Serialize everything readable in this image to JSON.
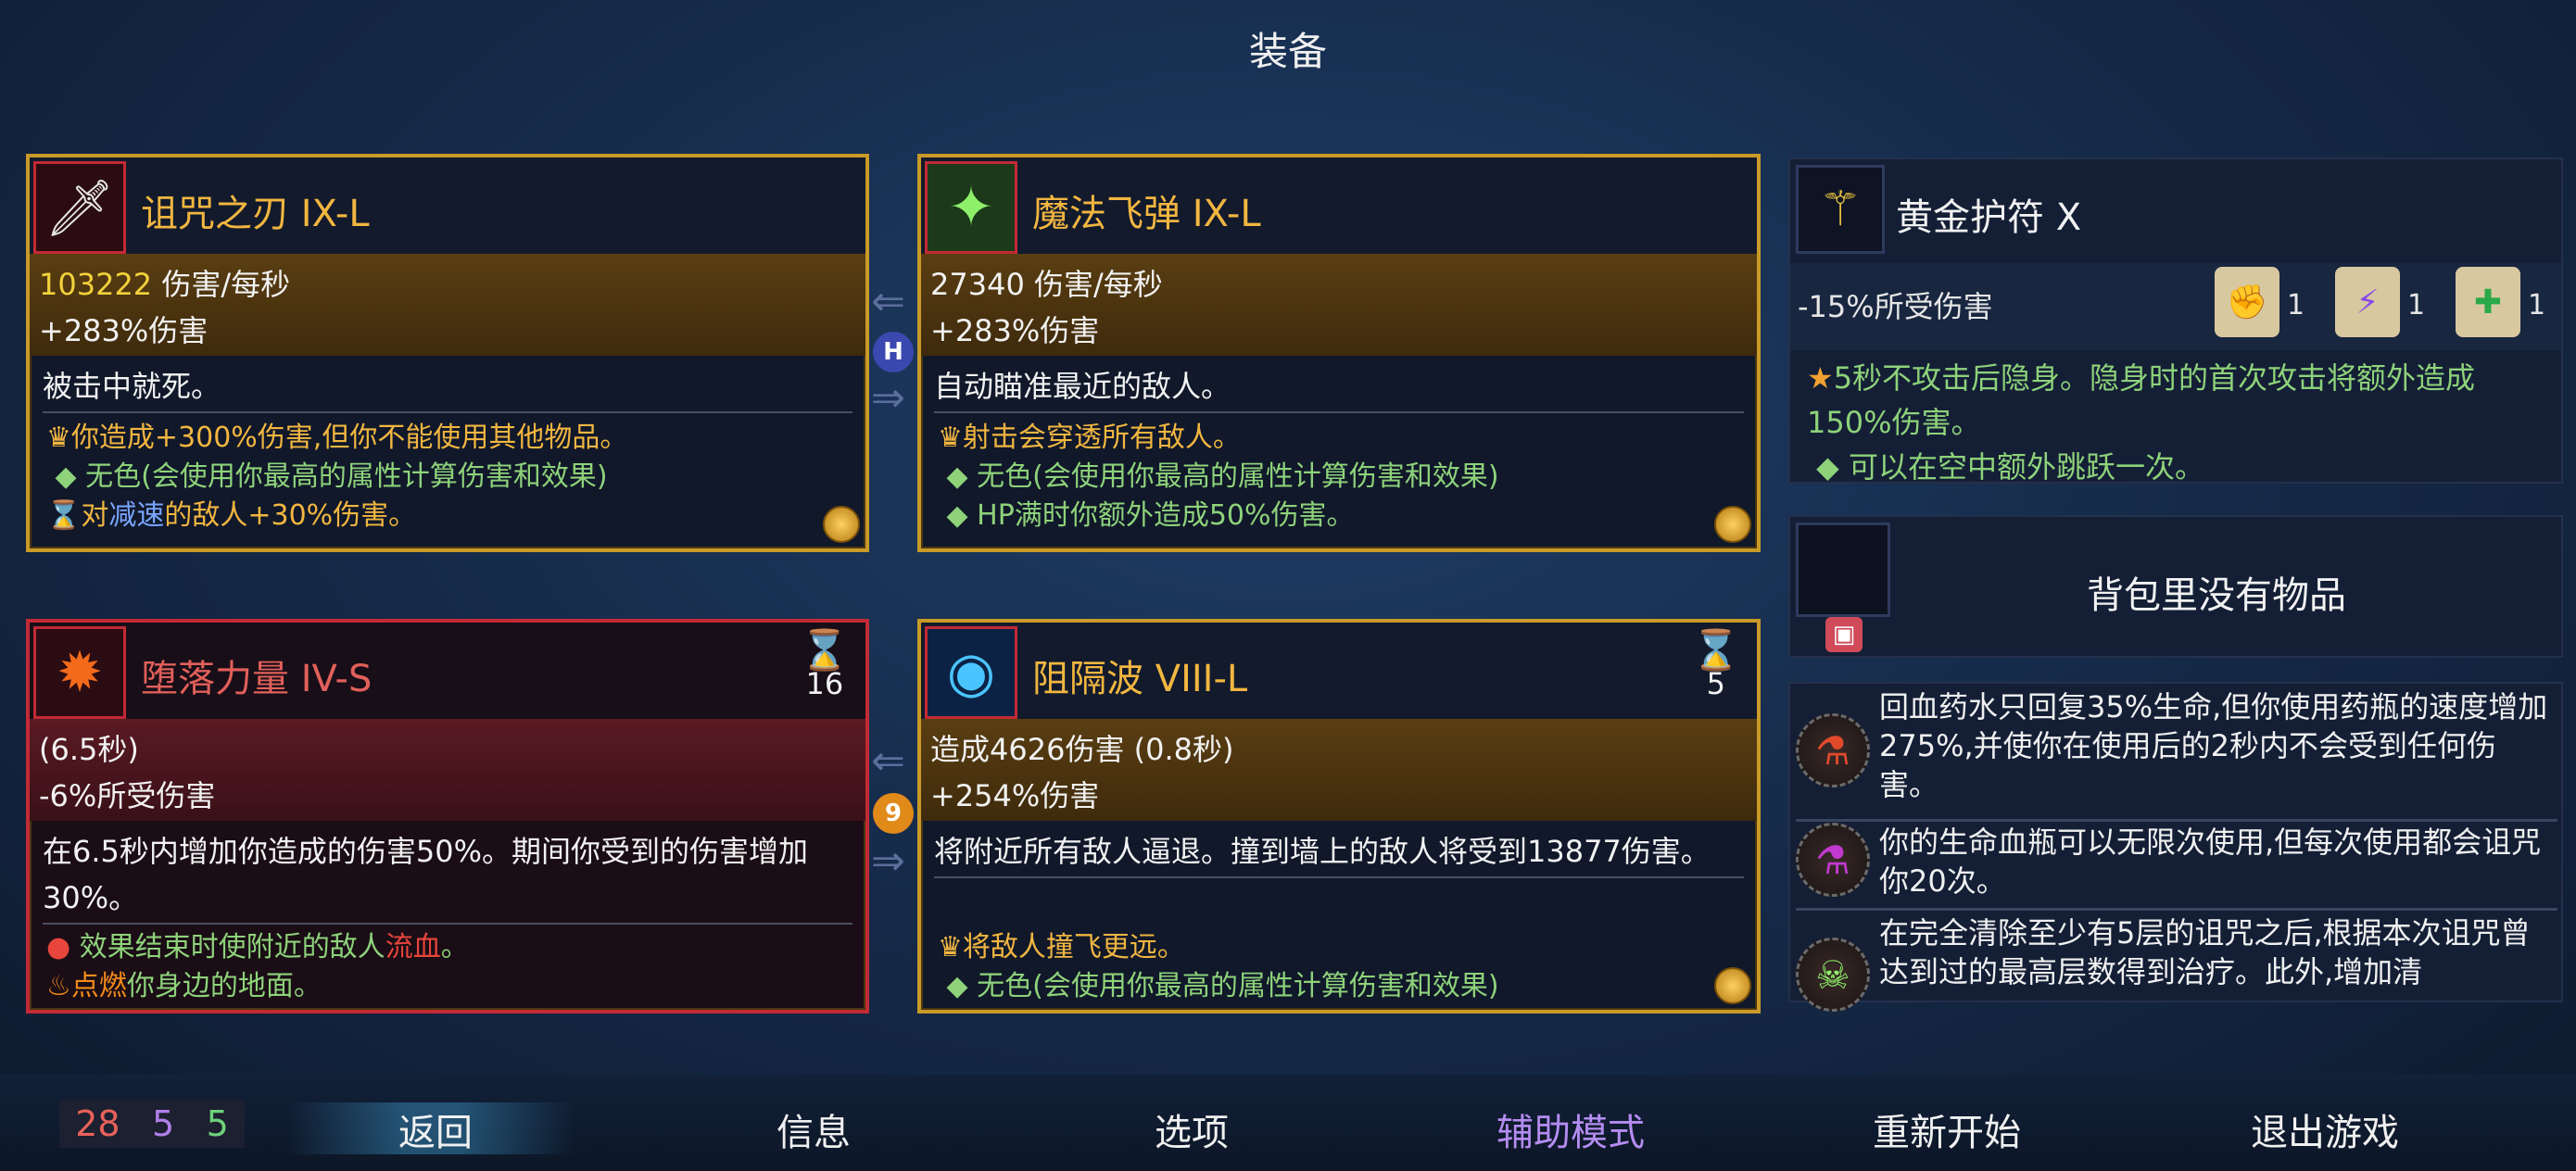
{
  "page_title": "装备",
  "weapons": [
    {
      "icon": "sword-icon",
      "name": "诅咒之刃 IX-L",
      "dps_value": "103222",
      "dps_label": " 伤害/每秒",
      "damage_bonus": "+283%伤害",
      "description": "被击中就死。",
      "effect1": "你造成+300%伤害,但你不能使用其他物品。",
      "effect2": "无色(会使用你最高的属性计算伤害和效果)",
      "effect3_pre": "对",
      "effect3_hl": "减速",
      "effect3_post": "的敌人+30%伤害。"
    },
    {
      "icon": "magic-missile-icon",
      "name": "魔法飞弹 IX-L",
      "dps_text": "27340 伤害/每秒",
      "damage_bonus": "+283%伤害",
      "description": "自动瞄准最近的敌人。",
      "effect1": "射击会穿透所有敌人。",
      "effect2": "无色(会使用你最高的属性计算伤害和效果)",
      "effect3": "HP满时你额外造成50%伤害。"
    }
  ],
  "skills": [
    {
      "icon": "fallen-power-icon",
      "name": "堕落力量 IV-S",
      "cooldown": "16",
      "duration": "(6.5秒)",
      "stat2": "-6%所受伤害",
      "description": "在6.5秒内增加你造成的伤害50%。期间你受到的伤害增加30%。",
      "effect1_pre": "效果结束时使附近的敌人",
      "effect1_hl": "流血",
      "effect1_post": "。",
      "effect2_hl": "点燃",
      "effect2_post": "你身边的地面。"
    },
    {
      "icon": "repel-wave-icon",
      "name": "阻隔波 VIII-L",
      "cooldown": "5",
      "stat1": "造成4626伤害 (0.8秒)",
      "stat2": "+254%伤害",
      "description": "将附近所有敌人逼退。撞到墙上的敌人将受到13877伤害。",
      "effect1": "将敌人撞飞更远。",
      "effect2": "无色(会使用你最高的属性计算伤害和效果)"
    }
  ],
  "swap_badges": {
    "weapons": "H",
    "skills": "9"
  },
  "amulet": {
    "icon": "amulet-icon",
    "name": "黄金护符 X",
    "stat": "-15%所受伤害",
    "scroll_counts": [
      "1",
      "1",
      "1"
    ],
    "effect1": "5秒不攻击后隐身。隐身时的首次攻击将额外造成150%伤害。",
    "effect2": "可以在空中额外跳跃一次。"
  },
  "backpack": {
    "empty_text": "背包里没有物品"
  },
  "mutations": [
    {
      "icon": "potion-icon",
      "text": "回血药水只回复35%生命,但你使用药瓶的速度增加275%,并使你在使用后的2秒内不会受到任何伤害。"
    },
    {
      "icon": "cursed-flask-icon",
      "text": "你的生命血瓶可以无限次使用,但每次使用都会诅咒你20次。"
    },
    {
      "icon": "skull-icon",
      "text": "在完全清除至少有5层的诅咒之后,根据本次诅咒曾达到过的最高层数得到治疗。此外,增加清"
    }
  ],
  "player_stats": {
    "brutality": "28",
    "tactics": "5",
    "survival": "5"
  },
  "nav": {
    "back": "返回",
    "info": "信息",
    "options": "选项",
    "assist": "辅助模式",
    "restart": "重新开始",
    "quit": "退出游戏"
  },
  "colors": {
    "brutality": "#e8625a",
    "tactics": "#b07ee8",
    "survival": "#6ed27a",
    "gold": "#f2b640",
    "assist": "#b48cf0"
  }
}
